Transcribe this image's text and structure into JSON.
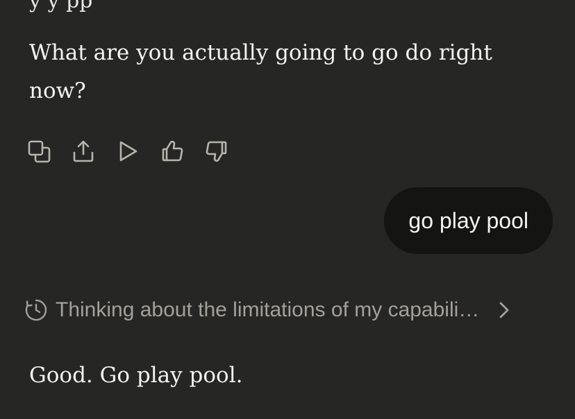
{
  "conversation": {
    "assistant_message_1": {
      "cutoff_text": "y              y            pp",
      "text": "What are you actually going to go do right now?"
    },
    "message_actions": [
      {
        "icon": "copy-icon",
        "label": ""
      },
      {
        "icon": "share-icon",
        "label": ""
      },
      {
        "icon": "play-icon",
        "label": ""
      },
      {
        "icon": "thumbs-up-icon",
        "label": ""
      },
      {
        "icon": "thumbs-down-icon",
        "label": ""
      }
    ],
    "user_message": {
      "text": "go play pool"
    },
    "thinking": {
      "icon": "clock-icon",
      "text": "Thinking about the limitations of my capabili…"
    },
    "assistant_message_2": {
      "text": "Good. Go play pool."
    }
  },
  "colors": {
    "background": "#262624",
    "text": "#f5f4ef",
    "muted": "#a3a199",
    "user_bubble": "#141413"
  }
}
